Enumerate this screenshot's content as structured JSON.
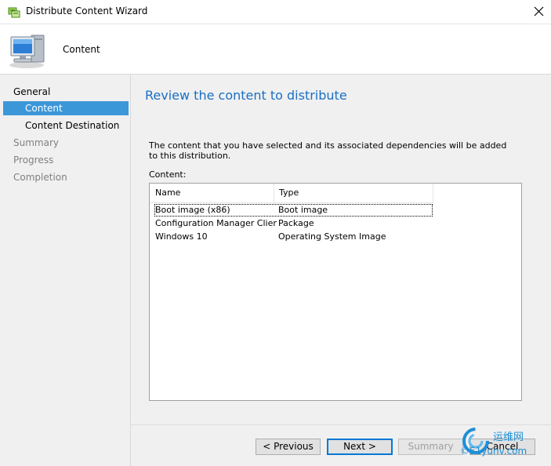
{
  "window": {
    "title": "Distribute Content Wizard",
    "close_glyph": "✕"
  },
  "header": {
    "title": "Content",
    "icon": "computer-icon"
  },
  "nav": {
    "items": [
      {
        "label": "General",
        "state": "normal"
      },
      {
        "label": "Content",
        "state": "active"
      },
      {
        "label": "Content Destination",
        "state": "normal"
      },
      {
        "label": "Summary",
        "state": "disabled"
      },
      {
        "label": "Progress",
        "state": "disabled"
      },
      {
        "label": "Completion",
        "state": "disabled"
      }
    ]
  },
  "main": {
    "heading": "Review the content to distribute",
    "description": "The content that you have selected and its associated dependencies will be added to this distribution.",
    "content_label": "Content:",
    "list": {
      "columns": [
        "Name",
        "Type"
      ],
      "rows": [
        {
          "name": "Boot image (x86)",
          "type": "Boot image"
        },
        {
          "name": "Configuration Manager Client ...",
          "type": "Package"
        },
        {
          "name": "Windows 10",
          "type": "Operating System Image"
        }
      ]
    }
  },
  "buttons": {
    "previous": "< Previous",
    "next": "Next >",
    "summary": "Summary",
    "cancel": "Cancel"
  },
  "watermark": {
    "line1": "运维网",
    "line2": "©51yunv.com"
  },
  "colors": {
    "accent": "#3c97d9",
    "heading": "#1a6fc4",
    "panel_bg": "#f0f0f0"
  }
}
